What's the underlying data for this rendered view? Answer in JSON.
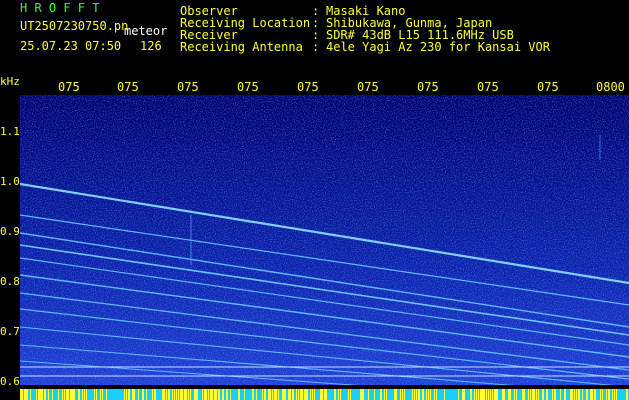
{
  "header": {
    "app_name": "H R O F F T",
    "filename": "UT2507230750.pn",
    "meteor_label": "meteor",
    "datetime": "25.07.23 07:50",
    "count": "126",
    "fields": [
      {
        "label": "Observer",
        "sep": ":",
        "value": "Masaki Kano"
      },
      {
        "label": "Receiving Location",
        "sep": ":",
        "value": "Shibukawa, Gunma, Japan"
      },
      {
        "label": "Receiver",
        "sep": ":",
        "value": "SDR# 43dB L15 111.6MHz USB"
      },
      {
        "label": "Receiving Antenna",
        "sep": ":",
        "value": "4ele Yagi Az 230 for Kansai VOR"
      }
    ]
  },
  "axis": {
    "unit": "kHz",
    "time_ticks": [
      "075",
      "075",
      "075",
      "075",
      "075",
      "075",
      "075",
      "075",
      "075",
      "0800"
    ],
    "freq_ticks": [
      "1.1",
      "1.0",
      "0.9",
      "0.8",
      "0.7",
      "0.6"
    ]
  },
  "colors": {
    "background": "#000000",
    "text_yellow": "#ffff33",
    "text_green": "#33ff33",
    "spectrum_base": "#00007a",
    "trace": "#66ccff"
  }
}
